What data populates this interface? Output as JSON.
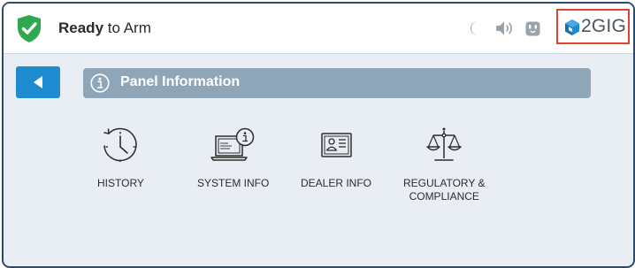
{
  "header": {
    "status_bold": "Ready",
    "status_rest": " to Arm",
    "brand": "2GIG",
    "icons": [
      "shield-check-icon",
      "moon-icon",
      "speaker-icon",
      "outlet-icon",
      "brand-cube-icon"
    ]
  },
  "colors": {
    "status_green": "#2fa84f",
    "back_button": "#1f8bd0",
    "title_bar": "#8fa6b8",
    "highlight_box": "#e0422f",
    "background": "#e8eef4"
  },
  "section": {
    "title": "Panel Information",
    "icon": "info-icon"
  },
  "tiles": [
    {
      "label": "HISTORY",
      "icon": "clock-history-icon"
    },
    {
      "label": "SYSTEM INFO",
      "icon": "laptop-info-icon"
    },
    {
      "label": "DEALER INFO",
      "icon": "id-card-icon"
    },
    {
      "label": "REGULATORY &\nCOMPLIANCE",
      "icon": "scales-icon"
    }
  ]
}
